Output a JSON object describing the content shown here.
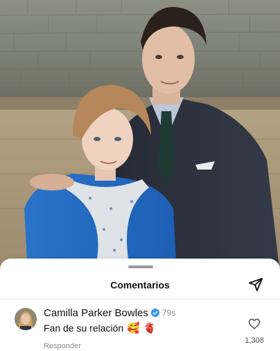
{
  "photo": {
    "description_icon": "portrait-photo"
  },
  "sheet": {
    "title": "Comentarios",
    "share_icon": "paper-plane-icon"
  },
  "comment": {
    "username": "Camilla Parker Bowles",
    "verified_icon": "verified-badge-icon",
    "time": "79s",
    "text": "Fan de su relación",
    "emojis": [
      "🥰",
      "🫀"
    ],
    "reply_label": "Responder",
    "like_icon": "heart-outline-icon",
    "like_count": "1,308"
  },
  "colors": {
    "text": "#111111",
    "muted": "#8e8e8e",
    "verified": "#3897f0",
    "sheet_bg": "#ffffff"
  }
}
